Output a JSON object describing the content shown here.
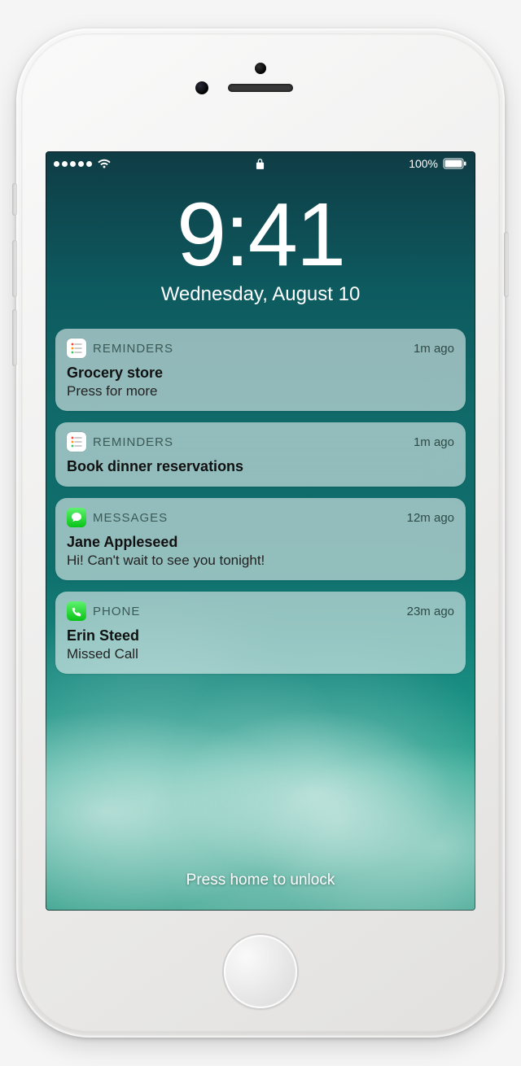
{
  "status": {
    "battery_label": "100%",
    "signal_dots": 5,
    "wifi_bars": 3
  },
  "clock": {
    "time": "9:41",
    "date": "Wednesday, August 10"
  },
  "unlock_hint": "Press home to unlock",
  "notifications": [
    {
      "icon": "reminders",
      "app": "REMINDERS",
      "time": "1m ago",
      "title": "Grocery store",
      "body": "Press for more"
    },
    {
      "icon": "reminders",
      "app": "REMINDERS",
      "time": "1m ago",
      "title": "Book dinner reservations",
      "body": ""
    },
    {
      "icon": "messages",
      "app": "MESSAGES",
      "time": "12m ago",
      "title": "Jane Appleseed",
      "body": "Hi! Can't wait to see you tonight!"
    },
    {
      "icon": "phone",
      "app": "PHONE",
      "time": "23m ago",
      "title": "Erin Steed",
      "body": "Missed Call"
    }
  ]
}
